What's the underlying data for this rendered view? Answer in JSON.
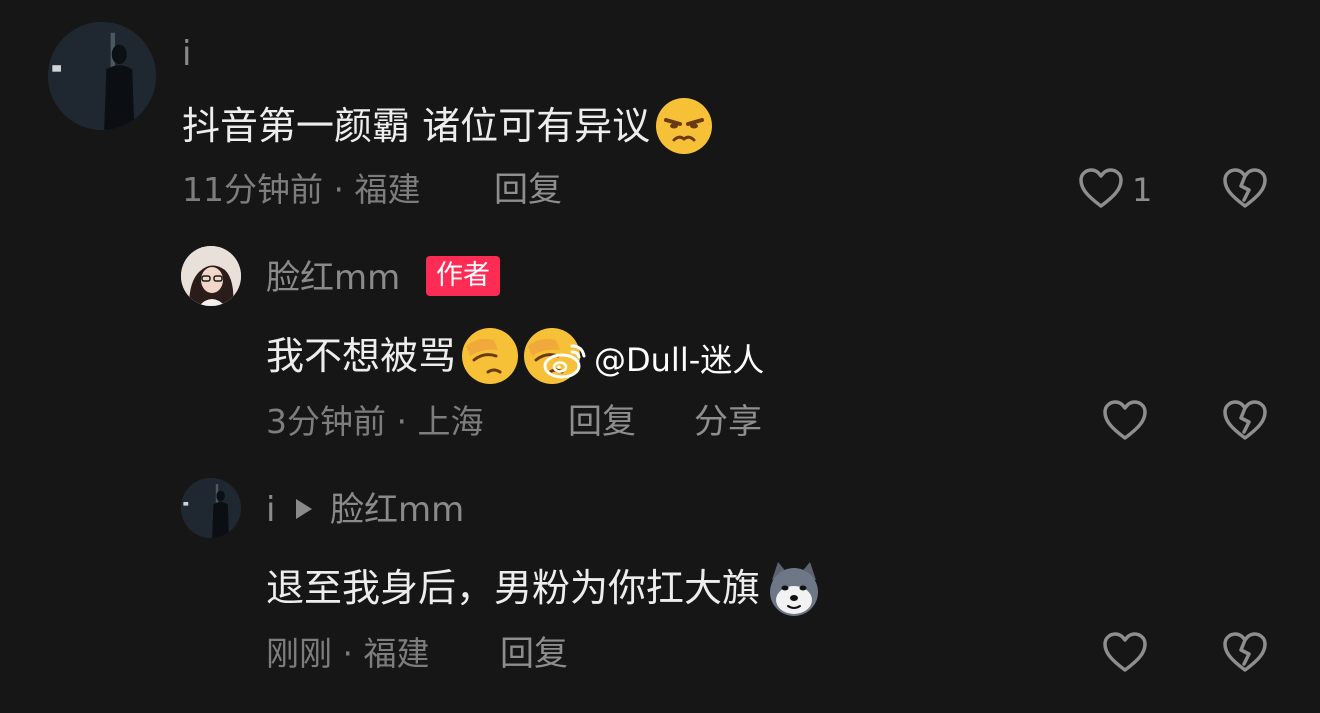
{
  "comments": [
    {
      "username": "i",
      "text": "抖音第一颜霸  诸位可有异议",
      "emoji_icon": "unamused-face-icon",
      "time": "11分钟前",
      "location": "福建",
      "reply_label": "回复",
      "like_count": "1"
    },
    {
      "username": "脸红mm",
      "badge": "作者",
      "text": "我不想被骂",
      "emoji_icon": "facepalm-icon",
      "time": "3分钟前",
      "location": "上海",
      "reply_label": "回复",
      "share_label": "分享"
    },
    {
      "username": "i",
      "reply_to": "脸红mm",
      "text": "退至我身后，男粉为你扛大旗",
      "emoji_icon": "doge-wolf-icon",
      "time": "刚刚",
      "location": "福建",
      "reply_label": "回复"
    }
  ],
  "meta_separator": "·",
  "watermark": {
    "logo_icon": "weibo-logo-icon",
    "text": "@Dull-迷人"
  },
  "colors": {
    "background": "#161616",
    "author_badge": "#fe2c55",
    "muted_text": "#7d7d7d"
  }
}
